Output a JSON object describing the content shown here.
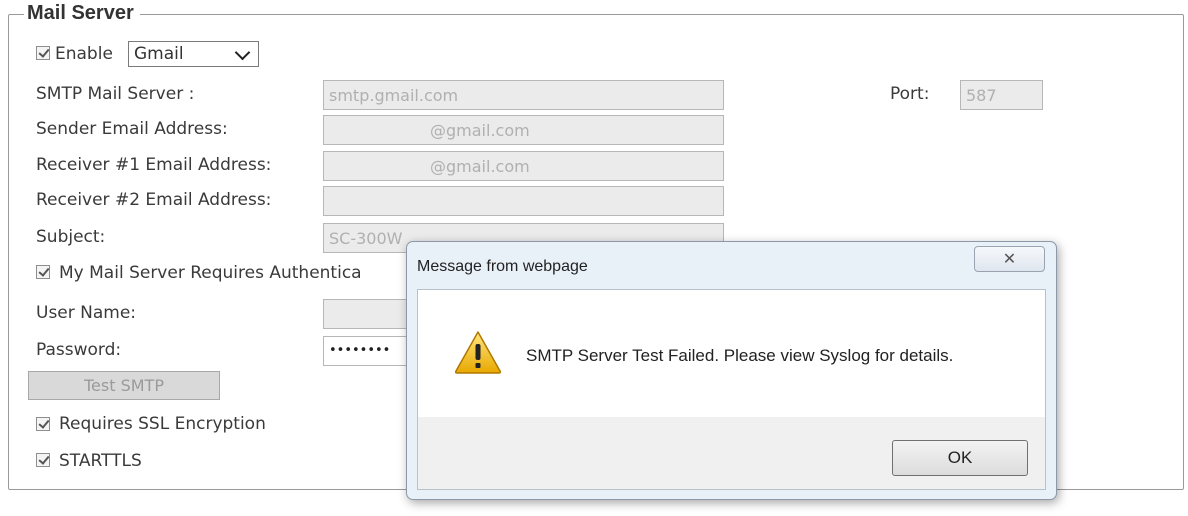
{
  "section": {
    "legend": "Mail Server"
  },
  "enable": {
    "label": "Enable",
    "checked": true,
    "provider": "Gmail"
  },
  "smtp": {
    "label": "SMTP Mail Server :",
    "value": "smtp.gmail.com",
    "port_label": "Port:",
    "port_value": "587"
  },
  "sender": {
    "label": "Sender Email Address:",
    "value": "@gmail.com"
  },
  "receiver1": {
    "label": "Receiver #1 Email Address:",
    "value": "@gmail.com"
  },
  "receiver2": {
    "label": "Receiver #2 Email Address:",
    "value": ""
  },
  "subject": {
    "label": "Subject:",
    "value": "SC-300W"
  },
  "auth": {
    "label": "My Mail Server Requires Authentica",
    "checked": true
  },
  "username": {
    "label": "User Name:",
    "value": ""
  },
  "password": {
    "label": "Password:",
    "value": "••••••••"
  },
  "test_button": {
    "label": "Test SMTP"
  },
  "ssl": {
    "label": "Requires SSL Encryption",
    "checked": true
  },
  "starttls": {
    "label": "STARTTLS",
    "checked": true
  },
  "dialog": {
    "title": "Message from webpage",
    "close_glyph": "✕",
    "icon": "warning-icon",
    "message": "SMTP Server Test Failed. Please view Syslog for details.",
    "ok_label": "OK"
  }
}
